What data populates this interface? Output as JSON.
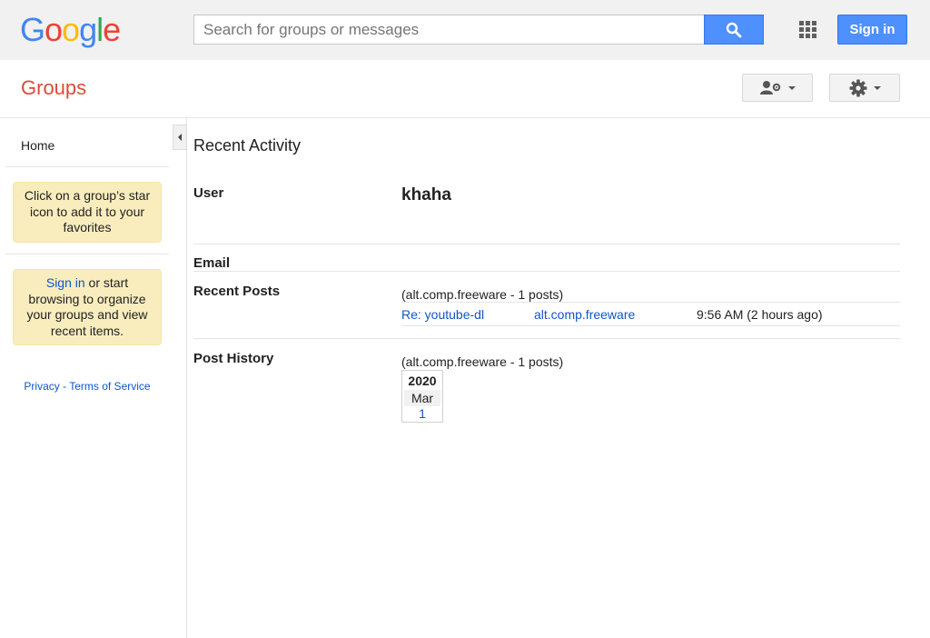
{
  "topbar": {
    "logo_letters": [
      {
        "char": "G",
        "color": "#4285f4"
      },
      {
        "char": "o",
        "color": "#ea4335"
      },
      {
        "char": "o",
        "color": "#fbbc05"
      },
      {
        "char": "g",
        "color": "#4285f4"
      },
      {
        "char": "l",
        "color": "#34a853"
      },
      {
        "char": "e",
        "color": "#ea4335"
      }
    ],
    "search_placeholder": "Search for groups or messages",
    "search_icon": "search-icon",
    "apps_icon": "apps-grid-icon",
    "signin_label": "Sign in",
    "accent_color": "#4d90fe"
  },
  "subheader": {
    "title": "Groups",
    "title_color": "#dd4b39",
    "buttons": [
      "person-settings-icon",
      "gear-icon"
    ]
  },
  "sidebar": {
    "home_label": "Home",
    "star_tip": "Click on a group’s star icon to add it to your favorites",
    "signin_tip_link": "Sign in",
    "signin_tip_rest": " or start browsing to organize your groups and view recent items.",
    "privacy_label": "Privacy",
    "separator": " - ",
    "terms_label": "Terms of Service"
  },
  "main": {
    "title": "Recent Activity",
    "user_label": "User",
    "username": "khaha",
    "email_label": "Email",
    "recent_posts_label": "Recent Posts",
    "recent_posts_count": "(alt.comp.freeware - 1 posts)",
    "posts": [
      {
        "subject": "Re: youtube-dl",
        "group": "alt.comp.freeware",
        "time": "9:56 AM (2 hours ago)"
      }
    ],
    "post_history_label": "Post History",
    "post_history_count": "(alt.comp.freeware - 1 posts)",
    "history": {
      "year": "2020",
      "month": "Mar",
      "count": "1"
    }
  }
}
